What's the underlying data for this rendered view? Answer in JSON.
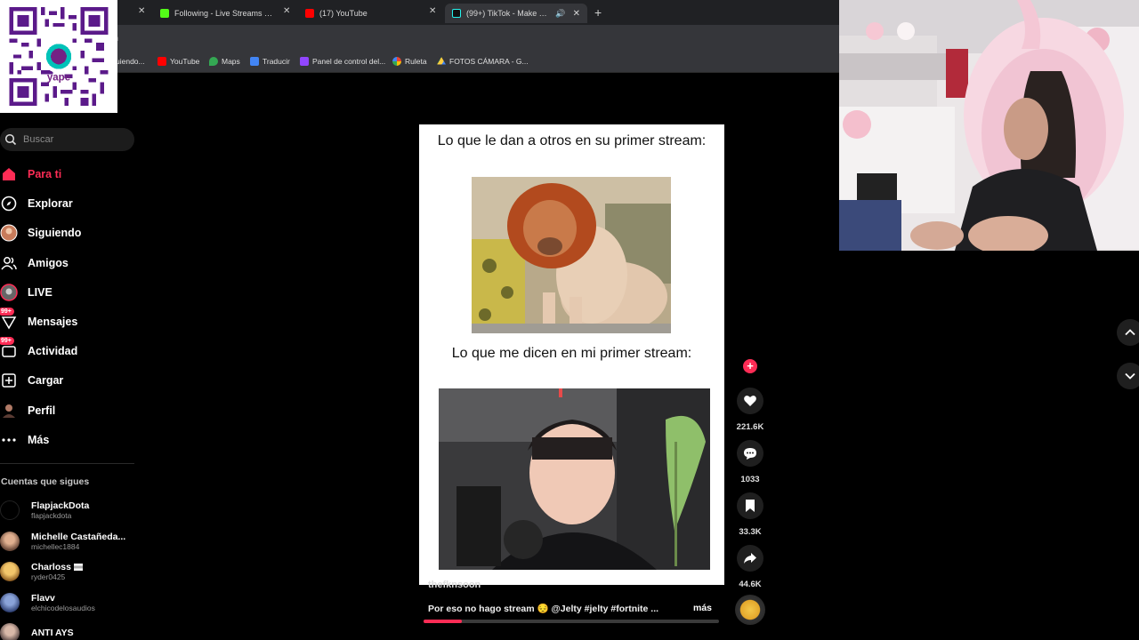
{
  "browser": {
    "tabs": [
      {
        "label": "Following - Live Streams on Ki",
        "icon": "kick-icon"
      },
      {
        "label": "(17) YouTube",
        "icon": "youtube-icon"
      },
      {
        "label": "(99+) TikTok - Make Your Da",
        "icon": "tiktok-icon",
        "active": true
      }
    ],
    "address_stub": "n",
    "bookmarks": [
      {
        "label": "uiendo...",
        "icon": "bookmark-icon"
      },
      {
        "label": "YouTube",
        "icon": "youtube-icon"
      },
      {
        "label": "Maps",
        "icon": "maps-icon"
      },
      {
        "label": "Traducir",
        "icon": "translate-icon"
      },
      {
        "label": "Panel de control del...",
        "icon": "twitch-icon"
      },
      {
        "label": "Ruleta",
        "icon": "wheel-icon"
      },
      {
        "label": "FOTOS CÁMARA - G...",
        "icon": "drive-icon"
      }
    ]
  },
  "overlay": {
    "qr_brand": "yape"
  },
  "sidebar": {
    "search_placeholder": "Buscar",
    "nav": [
      {
        "label": "Para ti",
        "icon": "home-icon"
      },
      {
        "label": "Explorar",
        "icon": "compass-icon"
      },
      {
        "label": "Siguiendo",
        "icon": "following-avatar-icon"
      },
      {
        "label": "Amigos",
        "icon": "friends-icon"
      },
      {
        "label": "LIVE",
        "icon": "live-icon"
      },
      {
        "label": "Mensajes",
        "icon": "messages-icon",
        "badge": "99+"
      },
      {
        "label": "Actividad",
        "icon": "activity-icon",
        "badge": "99+"
      },
      {
        "label": "Cargar",
        "icon": "upload-icon"
      },
      {
        "label": "Perfil",
        "icon": "profile-icon"
      },
      {
        "label": "Más",
        "icon": "more-icon"
      }
    ],
    "following_title": "Cuentas que sigues",
    "accounts": [
      {
        "name": "FlapjackDota",
        "handle": "flapjackdota"
      },
      {
        "name": "Michelle Castañeda...",
        "handle": "michellec1884"
      },
      {
        "name": "Charloss",
        "handle": "ryder0425"
      },
      {
        "name": "Flavv",
        "handle": "elchicodelosaudios"
      },
      {
        "name": "ANTI AYS",
        "handle": ""
      }
    ]
  },
  "video": {
    "caption_top": "Lo que le dan a otros en su primer stream:",
    "caption_bottom": "Lo que me dicen en mi primer stream:",
    "author": "thefknsoon",
    "description": "Por eso no hago stream 😔 @Jelty #jelty #fortnite ...",
    "more": "más",
    "progress": 0.13
  },
  "actions": {
    "likes": "221.6K",
    "comments": "1033",
    "saves": "33.3K",
    "shares": "44.6K"
  },
  "colors": {
    "accent": "#fe2c55",
    "background": "#000000",
    "chrome": "#35363a"
  }
}
